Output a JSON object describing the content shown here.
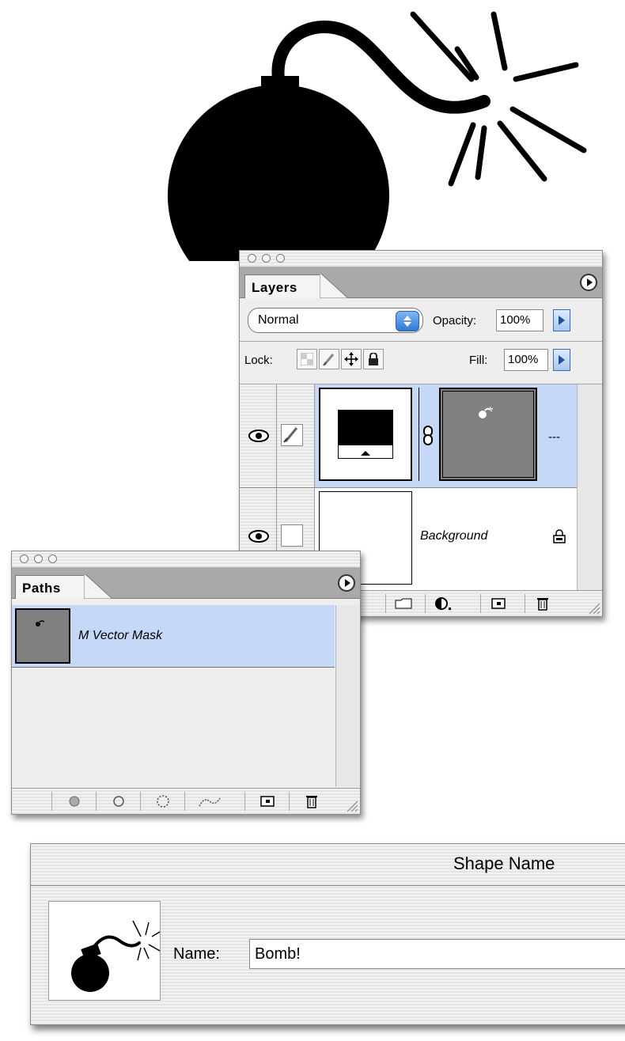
{
  "layers_panel": {
    "tab_label": "Layers",
    "blend_mode": "Normal",
    "opacity_label": "Opacity:",
    "opacity_value": "100%",
    "lock_label": "Lock:",
    "fill_label": "Fill:",
    "fill_value": "100%",
    "shape_layer_name": "---",
    "background_layer_name": "Background"
  },
  "paths_panel": {
    "tab_label": "Paths",
    "path_name": "M Vector Mask"
  },
  "dialog": {
    "title": "Shape Name",
    "name_label": "Name:",
    "name_value": "Bomb!"
  },
  "colors": {
    "selection": "#c5d8f7",
    "accent_blue": "#2f78d8",
    "mask_gray": "#808080"
  }
}
